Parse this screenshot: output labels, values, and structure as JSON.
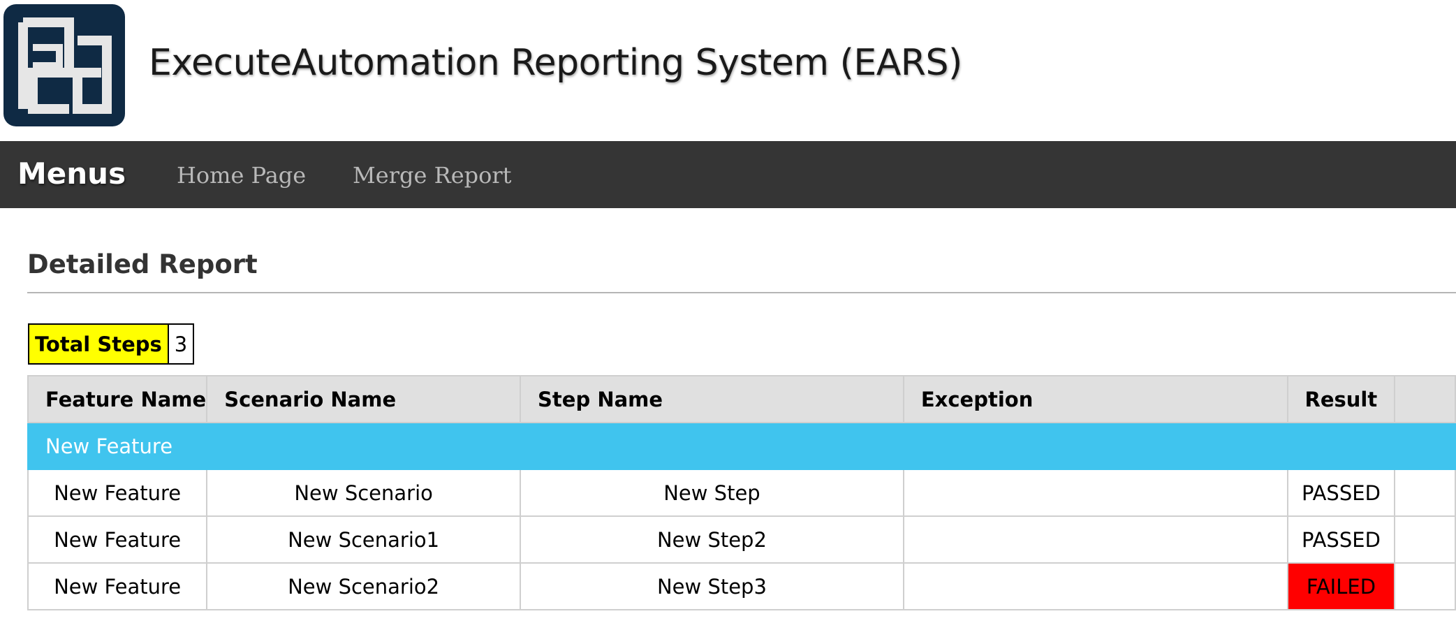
{
  "header": {
    "logo_icon": "ea-logo-icon",
    "title": "ExecuteAutomation Reporting System (EARS)"
  },
  "navbar": {
    "brand": "Menus",
    "links": [
      "Home Page",
      "Merge Report"
    ]
  },
  "page": {
    "heading": "Detailed Report"
  },
  "summary": {
    "total_steps_label": "Total Steps",
    "total_steps_value": "3"
  },
  "table": {
    "columns": [
      "Feature Name",
      "Scenario Name",
      "Step Name",
      "Exception",
      "Result",
      ""
    ],
    "group": "New Feature",
    "rows": [
      {
        "feature": "New Feature",
        "scenario": "New Scenario",
        "step": "New Step",
        "exception": "",
        "result": "PASSED"
      },
      {
        "feature": "New Feature",
        "scenario": "New Scenario1",
        "step": "New Step2",
        "exception": "",
        "result": "PASSED"
      },
      {
        "feature": "New Feature",
        "scenario": "New Scenario2",
        "step": "New Step3",
        "exception": "",
        "result": "FAILED"
      }
    ]
  },
  "colors": {
    "navbar": "#353535",
    "group_row": "#40c4ee",
    "failed": "#ff0000",
    "total_steps_highlight": "#ffff00",
    "logo_bg": "#0f2a44"
  }
}
